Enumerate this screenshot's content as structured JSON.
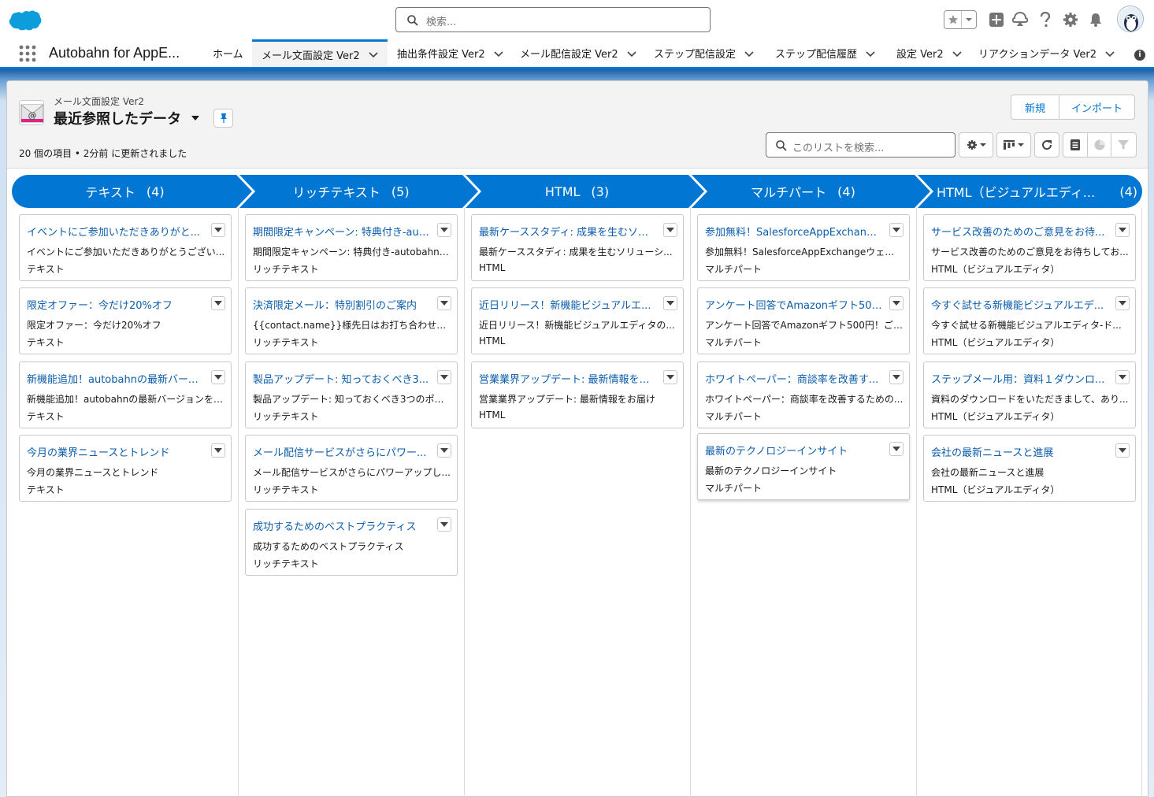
{
  "header": {
    "search_placeholder": "検索..."
  },
  "nav": {
    "app_name": "Autobahn for AppE...",
    "tabs": [
      {
        "label": "ホーム"
      },
      {
        "label": "メール文面設定 Ver2"
      },
      {
        "label": "抽出条件設定 Ver2"
      },
      {
        "label": "メール配信設定 Ver2"
      },
      {
        "label": "ステップ配信設定"
      },
      {
        "label": "ステップ配信履歴"
      },
      {
        "label": "設定 Ver2"
      },
      {
        "label": "リアクションデータ Ver2"
      }
    ]
  },
  "list_header": {
    "object_name": "メール文面設定 Ver2",
    "list_view_name": "最近参照したデータ",
    "status": "20 個の項目 • 2分前 に更新されました",
    "new_button": "新規",
    "import_button": "インポート",
    "search_placeholder": "このリストを検索..."
  },
  "colors": {
    "brand": "#0176d3",
    "link": "#0b5cab",
    "lane_header": "#0176d3"
  },
  "lanes": [
    {
      "title": "テキスト",
      "count": "(4)",
      "cards": [
        {
          "title": "イベントにご参加いただきありがと...",
          "body": "イベントにご参加いただきありがとうござい...",
          "type": "テキスト"
        },
        {
          "title": "限定オファー：今だけ20%オフ",
          "body": "限定オファー：今だけ20%オフ",
          "type": "テキスト"
        },
        {
          "title": "新機能追加！autobahnの最新バージ...",
          "body": "新機能追加！autobahnの最新バージョンをチ...",
          "type": "テキスト"
        },
        {
          "title": "今月の業界ニュースとトレンド",
          "body": "今月の業界ニュースとトレンド",
          "type": "テキスト"
        }
      ]
    },
    {
      "title": "リッチテキスト",
      "count": "(5)",
      "cards": [
        {
          "title": "期間限定キャンペーン: 特典付き-aut...",
          "body": "期間限定キャンペーン: 特典付き-autobahn f...",
          "type": "リッチテキスト"
        },
        {
          "title": "決済限定メール：特別割引のご案内",
          "body": "{{contact.name}}様先日はお打ち合わせ頂きあ...",
          "type": "リッチテキスト"
        },
        {
          "title": "製品アップデート: 知っておくべき3...",
          "body": "製品アップデート: 知っておくべき3つのポイ...",
          "type": "リッチテキスト"
        },
        {
          "title": "メール配信サービスがさらにパワー...",
          "body": "メール配信サービスがさらにパワーアップし...",
          "type": "リッチテキスト"
        },
        {
          "title": "成功するためのベストプラクティス",
          "body": "成功するためのベストプラクティス",
          "type": "リッチテキスト"
        }
      ]
    },
    {
      "title": "HTML",
      "count": "(3)",
      "cards": [
        {
          "title": "最新ケーススタディ: 成果を生むソリ...",
          "body": "最新ケーススタディ: 成果を生むソリューシ...",
          "type": "HTML"
        },
        {
          "title": "近日リリース！新機能ビジュアルエ...",
          "body": "近日リリース！新機能ビジュアルエディタの...",
          "type": "HTML"
        },
        {
          "title": "営業業界アップデート: 最新情報をお...",
          "body": "営業業界アップデート: 最新情報をお届け",
          "type": "HTML"
        }
      ]
    },
    {
      "title": "マルチパート",
      "count": "(4)",
      "cards": [
        {
          "title": "参加無料！SalesforceAppExchangeウ...",
          "body": "参加無料！SalesforceAppExchangeウェビナ...",
          "type": "マルチパート"
        },
        {
          "title": "アンケート回答でAmazonギフト500...",
          "body": "アンケート回答でAmazonギフト500円！ご協...",
          "type": "マルチパート"
        },
        {
          "title": "ホワイトペーパー：商談率を改善す...",
          "body": "ホワイトペーパー：商談率を改善するための...",
          "type": "マルチパート"
        },
        {
          "title": "最新のテクノロジーインサイト",
          "body": "最新のテクノロジーインサイト",
          "type": "マルチパート"
        }
      ]
    },
    {
      "title": "HTML（ビジュアルエディ...",
      "count": "(4)",
      "cards": [
        {
          "title": "サービス改善のためのご意見をお待...",
          "body": "サービス改善のためのご意見をお待ちしてお...",
          "type": "HTML（ビジュアルエディタ）"
        },
        {
          "title": "今すぐ試せる新機能ビジュアルエデ...",
          "body": "今すぐ試せる新機能ビジュアルエディタ-ド...",
          "type": "HTML（ビジュアルエディタ）"
        },
        {
          "title": "ステップメール用：資料１ダウンロ...",
          "body": "資料のダウンロードをいただきまして、あり...",
          "type": "HTML（ビジュアルエディタ）"
        },
        {
          "title": "会社の最新ニュースと進展",
          "body": "会社の最新ニュースと進展",
          "type": "HTML（ビジュアルエディタ）"
        }
      ]
    }
  ]
}
